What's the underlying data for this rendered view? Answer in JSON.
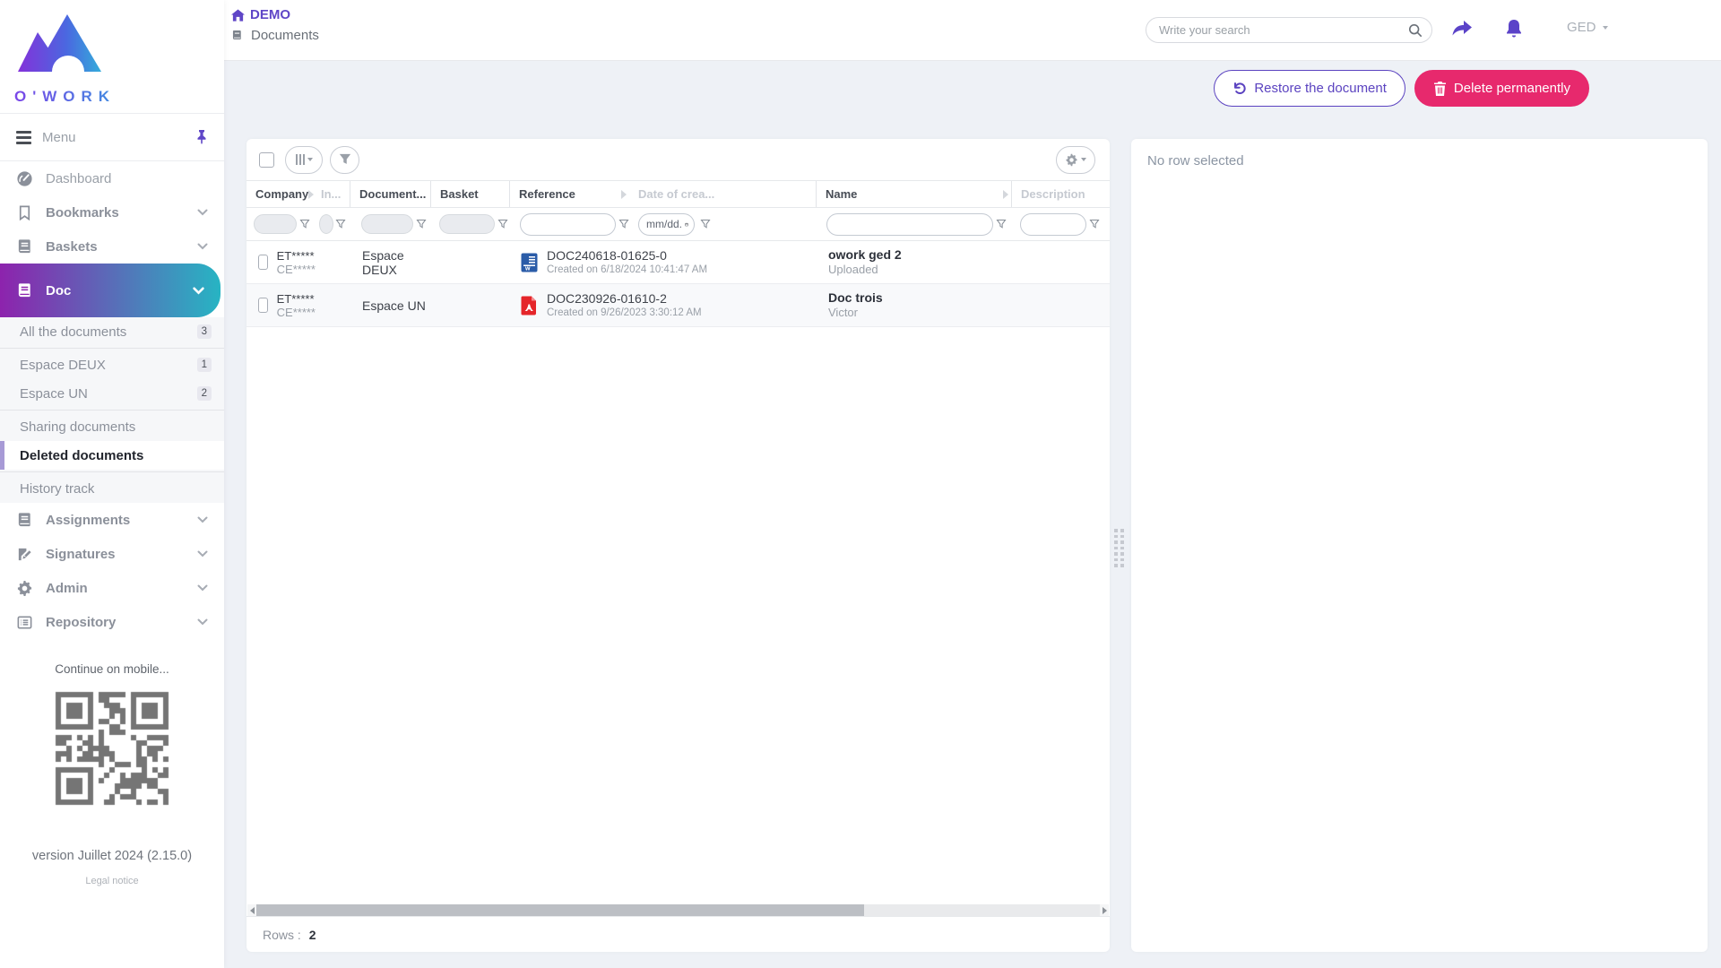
{
  "brand": {
    "logo_text": "O'WORK"
  },
  "topbar": {
    "home_title": "DEMO",
    "page_title": "Documents",
    "search_placeholder": "Write your search",
    "profile_label": "GED"
  },
  "actionbar": {
    "restore_label": "Restore the document",
    "delete_label": "Delete permanently"
  },
  "sidebar": {
    "menu_label": "Menu",
    "nav": [
      {
        "label": "Dashboard"
      },
      {
        "label": "Bookmarks"
      },
      {
        "label": "Baskets"
      },
      {
        "label": "Doc"
      },
      {
        "label": "Assignments"
      },
      {
        "label": "Signatures"
      },
      {
        "label": "Admin"
      },
      {
        "label": "Repository"
      }
    ],
    "doc_children": [
      {
        "label": "All the documents",
        "badge": "3"
      },
      {
        "label": "Espace DEUX",
        "badge": "1"
      },
      {
        "label": "Espace UN",
        "badge": "2"
      },
      {
        "label": "Sharing documents",
        "badge": ""
      },
      {
        "label": "Deleted documents",
        "badge": ""
      },
      {
        "label": "History track",
        "badge": ""
      }
    ],
    "mobile_hint": "Continue on mobile...",
    "version": "version Juillet 2024 (2.15.0)",
    "legal_notice": "Legal notice"
  },
  "table": {
    "columns": [
      {
        "label": "Company"
      },
      {
        "label": "In..."
      },
      {
        "label": "Document..."
      },
      {
        "label": "Basket"
      },
      {
        "label": "Reference"
      },
      {
        "label": "Date of crea..."
      },
      {
        "label": "Name"
      },
      {
        "label": "Description"
      }
    ],
    "filters": {
      "date_placeholder": "mm/dd."
    },
    "rows": [
      {
        "company_code": "ET*****",
        "company_sub": "CE*****",
        "document": "Espace DEUX",
        "basket": "",
        "file_type": "word",
        "reference": "DOC240618-01625-0",
        "created": "Created on 6/18/2024 10:41:47 AM",
        "name": "owork ged 2",
        "name_sub": "Uploaded",
        "description": ""
      },
      {
        "company_code": "ET*****",
        "company_sub": "CE*****",
        "document": "Espace UN",
        "basket": "",
        "file_type": "pdf",
        "reference": "DOC230926-01610-2",
        "created": "Created on 9/26/2023 3:30:12 AM",
        "name": "Doc trois",
        "name_sub": "Victor",
        "description": ""
      }
    ],
    "footer": {
      "rows_label": "Rows :",
      "rows_count": "2"
    }
  },
  "detail_panel": {
    "empty_message": "No row selected"
  },
  "colors": {
    "accent_purple": "#5b43c8",
    "accent_pink": "#e7296d",
    "doc_gradient_start": "#8d23ad",
    "doc_gradient_end": "#27b4c3",
    "word_icon": "#2b5ca8",
    "pdf_icon": "#e5252a"
  }
}
